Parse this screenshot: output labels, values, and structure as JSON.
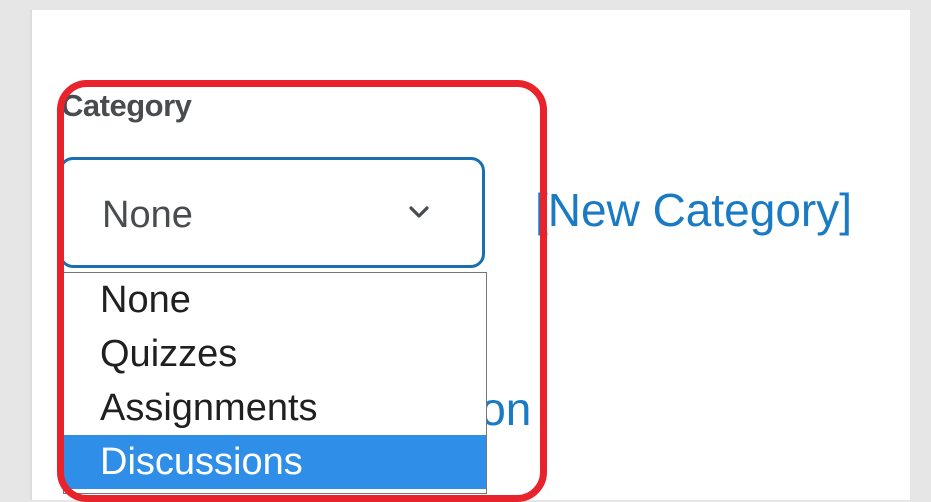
{
  "category": {
    "label": "Category",
    "selected_value": "None",
    "options": [
      "None",
      "Quizzes",
      "Assignments",
      "Discussions"
    ],
    "highlighted_option": "Discussions"
  },
  "links": {
    "new_category": "[New Category]",
    "partially_hidden": "ion"
  },
  "colors": {
    "link": "#1a7ac4",
    "focus_border": "#1a6fb0",
    "selected_option_bg": "#2f8ee8",
    "annotation_frame": "#e8232c"
  },
  "icons": {
    "select_arrow": "chevron-down-icon"
  }
}
